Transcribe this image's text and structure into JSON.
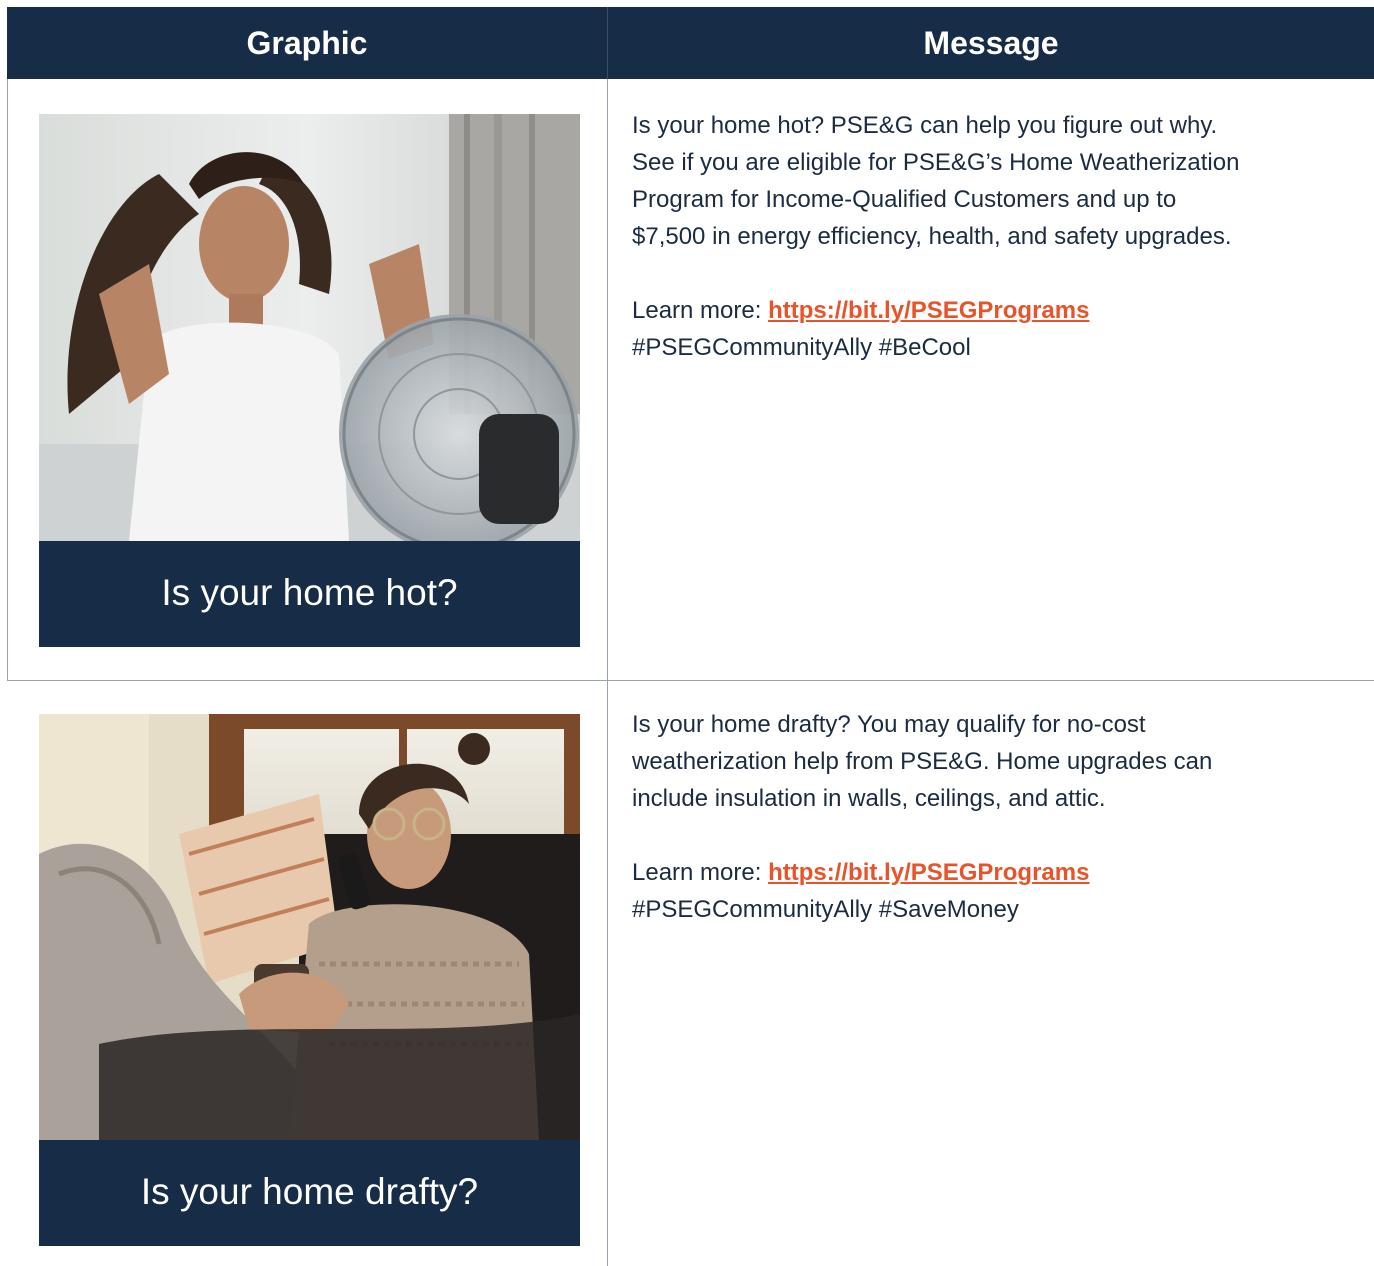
{
  "table": {
    "headers": {
      "graphic": "Graphic",
      "message": "Message"
    },
    "rows": [
      {
        "graphic_caption": "Is your home hot?",
        "message_lines": [
          "Is your home hot? PSE&G can help you figure out why.",
          "See if you are eligible for PSE&G’s Home Weatherization",
          "Program for Income-Qualified Customers and up to",
          "$7,500 in energy efficiency, health, and safety upgrades."
        ],
        "learn_more_label": "Learn more: ",
        "link_text": "https://bit.ly/PSEGPrograms",
        "hashtags": "#PSEGCommunityAlly #BeCool"
      },
      {
        "graphic_caption": "Is your home drafty?",
        "message_lines": [
          "Is your home drafty? You may qualify for no-cost",
          "weatherization help from PSE&G. Home upgrades can",
          "include insulation in walls, ceilings, and attic."
        ],
        "learn_more_label": "Learn more: ",
        "link_text": "https://bit.ly/PSEGPrograms",
        "hashtags": "#PSEGCommunityAlly #SaveMoney"
      }
    ]
  },
  "colors": {
    "header_bg": "#172c46",
    "link": "#e8532a",
    "body_text": "#1b2b40"
  }
}
